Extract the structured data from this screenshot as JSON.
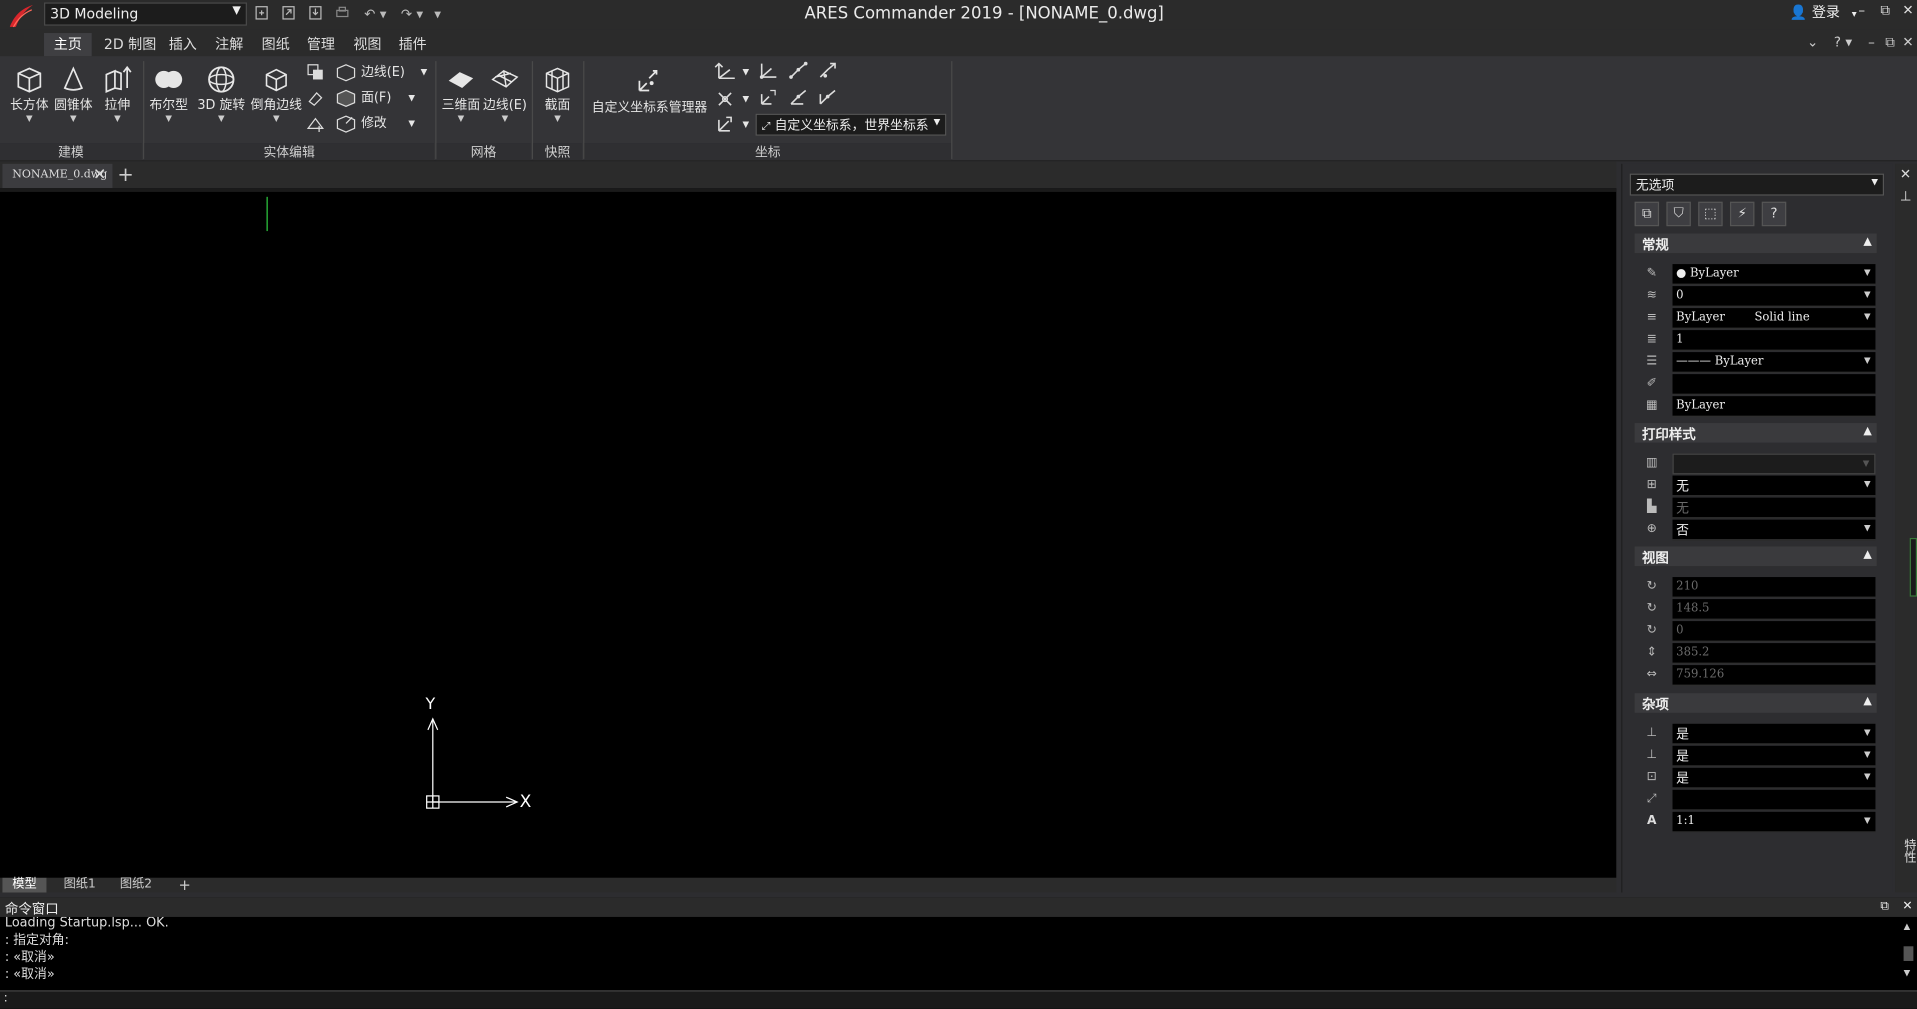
{
  "window": {
    "title": "ARES Commander 2019 - [NONAME_0.dwg]",
    "workspace": "3D Modeling",
    "login": "登录",
    "win_min": "–",
    "win_restore": "⧉",
    "win_close": "✕",
    "help": "?"
  },
  "ribbon_tabs": [
    "主页",
    "2D 制图",
    "插入",
    "注解",
    "图纸",
    "管理",
    "视图",
    "插件"
  ],
  "ribbon": {
    "modeling": {
      "label": "建模",
      "buttons": [
        "长方体",
        "圆锥体",
        "拉伸"
      ]
    },
    "solid_edit": {
      "label": "实体编辑",
      "buttons": [
        "布尔型",
        "3D 旋转",
        "倒角边线"
      ],
      "small": [
        "边线(E)",
        "面(F)",
        "修改"
      ]
    },
    "mesh": {
      "label": "网格",
      "buttons": [
        "三维面",
        "边线(E)"
      ]
    },
    "snapshot": {
      "label": "快照",
      "buttons": [
        "截面"
      ]
    },
    "coordinates": {
      "label": "坐标",
      "manager": "自定义坐标系管理器",
      "ucs_select": "自定义坐标系，世界坐标系"
    }
  },
  "doc_tab": "NONAME_0.dwg",
  "layout_tabs": [
    "模型",
    "图纸1",
    "图纸2"
  ],
  "ucs_axis": {
    "x": "X",
    "y": "Y"
  },
  "command": {
    "title": "命令窗口",
    "lines": [
      "Loading Startup.lsp...  OK.",
      ": 指定对角:",
      ": «取消»",
      ": «取消»"
    ],
    "prompt": ":"
  },
  "properties": {
    "selection": "无选项",
    "sections": {
      "general": {
        "title": "常规",
        "rows": [
          {
            "icon": "color-icon",
            "value": "● ByLayer"
          },
          {
            "icon": "layer-icon",
            "value": "0"
          },
          {
            "icon": "linetype-icon",
            "value": "ByLayer        Solid line"
          },
          {
            "icon": "linescale-icon",
            "value": "1"
          },
          {
            "icon": "lineweight-icon",
            "value": "——— ByLayer"
          },
          {
            "icon": "thickness-icon",
            "value": ""
          },
          {
            "icon": "transparency-icon",
            "value": "ByLayer"
          }
        ]
      },
      "print": {
        "title": "打印样式",
        "rows": [
          {
            "icon": "plotstyle-icon",
            "value": ""
          },
          {
            "icon": "plotstyle-table-icon",
            "value": "无"
          },
          {
            "icon": "plot-attach-icon",
            "value": "无"
          },
          {
            "icon": "plot-available-icon",
            "value": "否"
          }
        ]
      },
      "view": {
        "title": "视图",
        "rows": [
          {
            "icon": "center-x-icon",
            "value": "210"
          },
          {
            "icon": "center-y-icon",
            "value": "148.5"
          },
          {
            "icon": "center-z-icon",
            "value": "0"
          },
          {
            "icon": "height-icon",
            "value": "385.2"
          },
          {
            "icon": "width-icon",
            "value": "759.126"
          }
        ]
      },
      "misc": {
        "title": "杂项",
        "rows": [
          {
            "icon": "ucs-on-icon",
            "value": "是"
          },
          {
            "icon": "ucs-origin-icon",
            "value": "是"
          },
          {
            "icon": "ucs-viewport-icon",
            "value": "是"
          },
          {
            "icon": "ucs-name-icon",
            "value": ""
          },
          {
            "icon": "annotation-scale-icon",
            "value": "1:1"
          }
        ]
      }
    },
    "side_label": "特性"
  },
  "colors": {
    "canvas": "#000000",
    "panel": "#2d2d30",
    "ribbon": "#343437",
    "accent_red": "#d8262c",
    "cursor_green": "#2ecc40"
  }
}
